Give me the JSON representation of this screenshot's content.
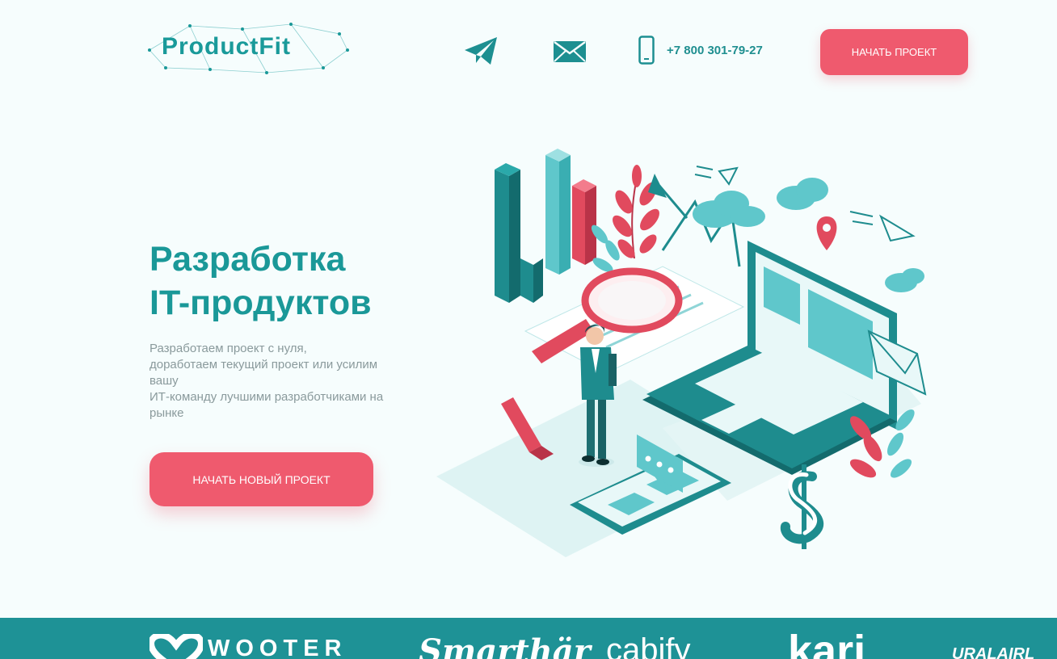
{
  "brand": {
    "logo_text": "ProductFit"
  },
  "header": {
    "telegram_icon": "telegram-icon",
    "mail_icon": "mail-icon",
    "phone_icon": "phone-icon",
    "phone": "+7 800 301-79-27",
    "cta_label": "НАЧАТЬ ПРОЕКТ"
  },
  "hero": {
    "title_line1": "Разработка",
    "title_line2": "IT-продуктов",
    "text_lines": [
      "Разработаем проект с нуля,",
      "доработаем текущий проект или усилим",
      "вашу",
      "ИТ-команду лучшими разработчиками на",
      "рынке"
    ],
    "cta_label": "НАЧАТЬ НОВЫЙ ПРОЕКТ"
  },
  "clients": {
    "items": [
      "WOOTER",
      "Smarthär",
      "cabify",
      "kari",
      "URALAIRL"
    ]
  },
  "colors": {
    "accent": "#ef5a6e",
    "brand": "#1a9898",
    "band": "#1e9296",
    "background": "#f6fdfd"
  }
}
